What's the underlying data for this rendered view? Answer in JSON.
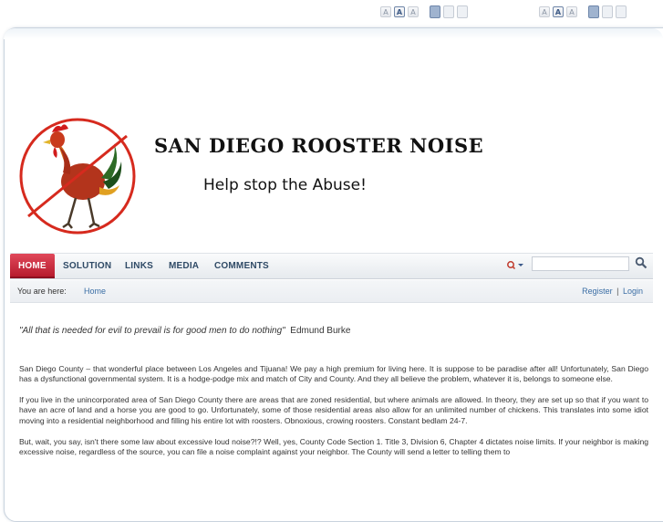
{
  "toolbar": {
    "group1": {
      "font_buttons": [
        "A",
        "A",
        "A"
      ],
      "active_font_index": 1
    },
    "group2": {
      "font_buttons": [
        "A",
        "A",
        "A"
      ],
      "active_font_index": 1
    }
  },
  "header": {
    "site_title": "SAN DIEGO ROOSTER NOISE",
    "tagline": "Help stop the Abuse!",
    "logo_icon": "no-rooster-icon"
  },
  "nav": {
    "items": [
      {
        "label": "HOME",
        "active": true
      },
      {
        "label": "SOLUTION"
      },
      {
        "label": "LINKS"
      },
      {
        "label": "MEDIA"
      },
      {
        "label": "COMMENTS"
      }
    ]
  },
  "search": {
    "value": "",
    "options_icon": "search-options-icon",
    "button_icon": "magnifier-icon"
  },
  "breadcrumb": {
    "label": "You are here:",
    "home": "Home"
  },
  "user_links": {
    "register": "Register",
    "separator": "|",
    "login": "Login"
  },
  "article": {
    "quote": "\"All that is needed for evil to prevail is for good men to do nothing\"",
    "quote_author": "Edmund Burke",
    "paragraphs": [
      "San Diego County – that wonderful place between Los Angeles and Tijuana! We pay a high premium for living here. It is suppose to be paradise after all! Unfortunately, San Diego has a dysfunctional governmental system. It is a hodge-podge mix and match of City and County.   And they all believe the problem, whatever it is, belongs to someone else.",
      "If you live in the unincorporated area of San Diego County there are areas that are zoned residential, but where animals are allowed. In theory, they are set up so that if you want to have an acre of land and a horse you are good to go. Unfortunately, some of those residential areas also allow for an unlimited number of chickens. This translates into some idiot moving into a residential neighborhood and filling his entire lot with roosters. Obnoxious, crowing roosters. Constant bedlam 24-7.",
      "But, wait, you say, isn't there some law about excessive loud noise?!? Well, yes, County Code Section 1. Title 3, Division 6, Chapter 4 dictates noise limits. If your neighbor is making excessive noise, regardless of the source, you can file a noise complaint against your neighbor. The County will send a letter to telling them to"
    ]
  }
}
